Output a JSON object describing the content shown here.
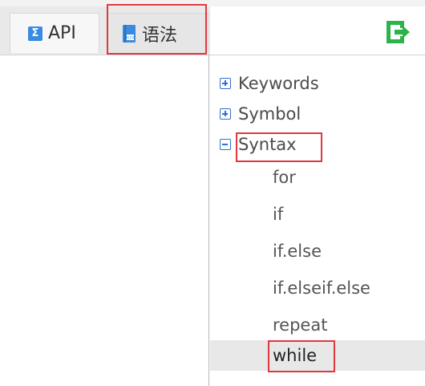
{
  "tabs": [
    {
      "label": "API",
      "icon": "sigma-icon"
    },
    {
      "label": "语法",
      "icon": "code-book-icon"
    }
  ],
  "toolbar": {
    "exit_icon": "exit-icon"
  },
  "tree": {
    "nodes": [
      {
        "label": "Keywords",
        "expanded": false
      },
      {
        "label": "Symbol",
        "expanded": false
      },
      {
        "label": "Syntax",
        "expanded": true
      }
    ],
    "syntax_children": [
      "for",
      "if",
      "if.else",
      "if.elseif.else",
      "repeat",
      "while"
    ],
    "selected": "while"
  },
  "colors": {
    "highlight": "#e0383e",
    "accent_blue": "#2f6fd0",
    "exit_green": "#2db34a"
  }
}
